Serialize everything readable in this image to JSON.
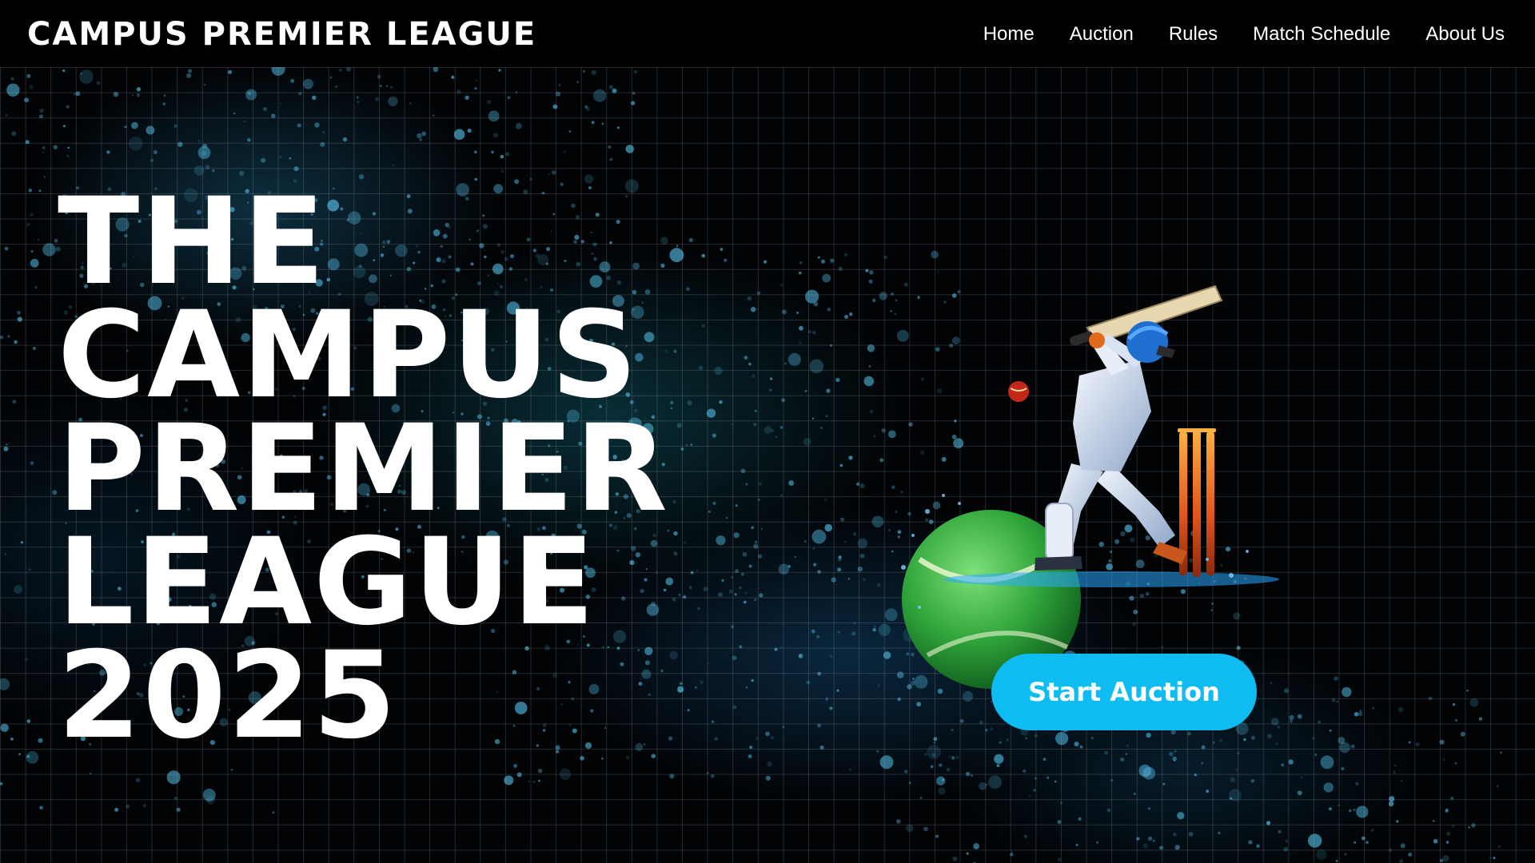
{
  "header": {
    "brand": "CAMPUS PREMIER LEAGUE",
    "nav": [
      {
        "label": "Home"
      },
      {
        "label": "Auction"
      },
      {
        "label": "Rules"
      },
      {
        "label": "Match Schedule"
      },
      {
        "label": "About Us"
      }
    ]
  },
  "hero": {
    "title_lines": [
      "THE",
      "CAMPUS",
      "PREMIER",
      "LEAGUE",
      "2025"
    ],
    "cta_label": "Start Auction",
    "illustration": "cricket-batsman-illustration"
  },
  "colors": {
    "background": "#000000",
    "text": "#ffffff",
    "accent": "#0fbcf2",
    "particles": "#4fb3d9",
    "ball": "#3fbf4a"
  }
}
